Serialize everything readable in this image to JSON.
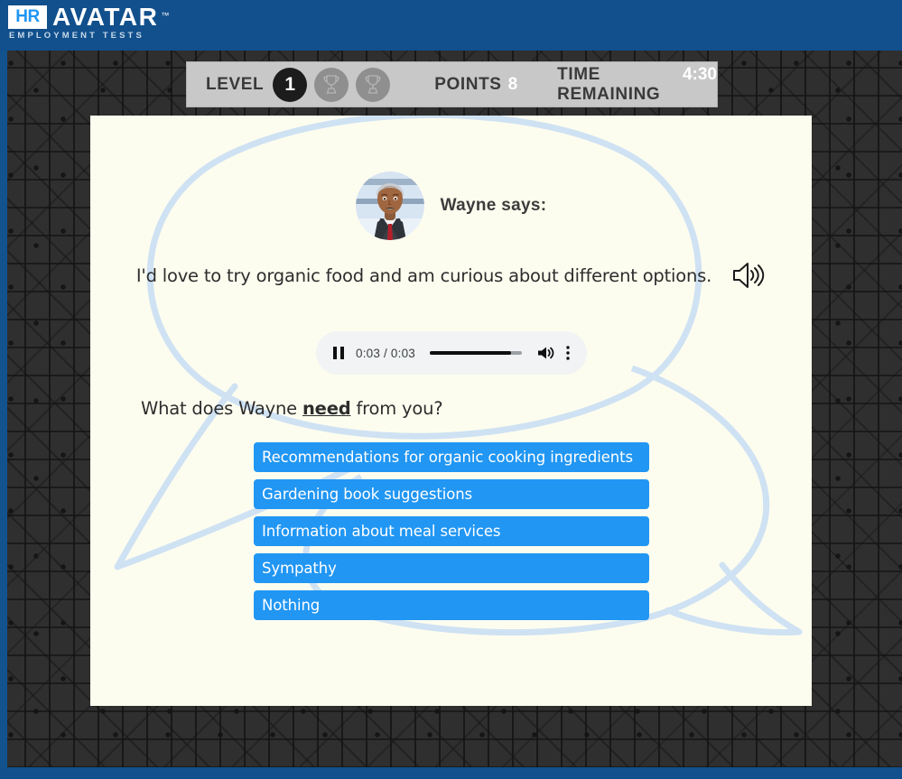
{
  "brand": {
    "logo_hr": "HR",
    "logo_word": "AVATAR",
    "logo_tm": "™",
    "logo_sub": "EMPLOYMENT TESTS",
    "header_color": "#11508c",
    "accent_color": "#2196f3"
  },
  "statusbar": {
    "level_label": "LEVEL",
    "level_value": "1",
    "trophy_icon": "trophy-icon",
    "trophies": 2,
    "points_label": "POINTS",
    "points_value": "8",
    "time_label": "TIME REMAINING",
    "time_value": "4:30"
  },
  "scenario": {
    "avatar_name": "avatar-wayne",
    "speaker_heading": "Wayne says:",
    "dialogue": "I'd love to try organic food and am curious about different options.",
    "speaker_icon": "speaker-icon",
    "question_prefix": "What does Wayne ",
    "question_emphasis": "need",
    "question_suffix": " from you?"
  },
  "audio_player": {
    "state_icon": "pause-icon",
    "time_display": "0:03 / 0:03",
    "progress_percent": 88,
    "volume_icon": "volume-icon",
    "menu_icon": "more-vertical-icon"
  },
  "options": [
    {
      "label": "Recommendations for organic cooking ingredients"
    },
    {
      "label": "Gardening book suggestions"
    },
    {
      "label": "Information about meal services"
    },
    {
      "label": "Sympathy"
    },
    {
      "label": "Nothing"
    }
  ]
}
